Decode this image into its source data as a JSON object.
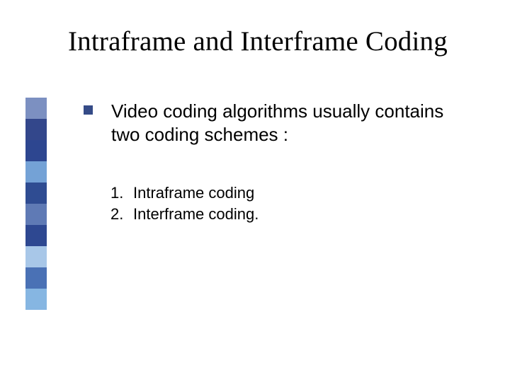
{
  "title": "Intraframe and Interframe Coding",
  "bullet": {
    "text": "Video coding algorithms usually contains two coding schemes :"
  },
  "list": {
    "items": [
      {
        "num": "1.",
        "label": "Intraframe coding"
      },
      {
        "num": "2.",
        "label": "Interframe coding."
      }
    ]
  },
  "sidebar": {
    "colors": [
      "#7c90c1",
      "#33478b",
      "#2d4690",
      "#74a2d6",
      "#2f4c92",
      "#5f7ab5",
      "#2e4891",
      "#a8c7e8",
      "#4a71b5",
      "#86b6e2"
    ]
  }
}
